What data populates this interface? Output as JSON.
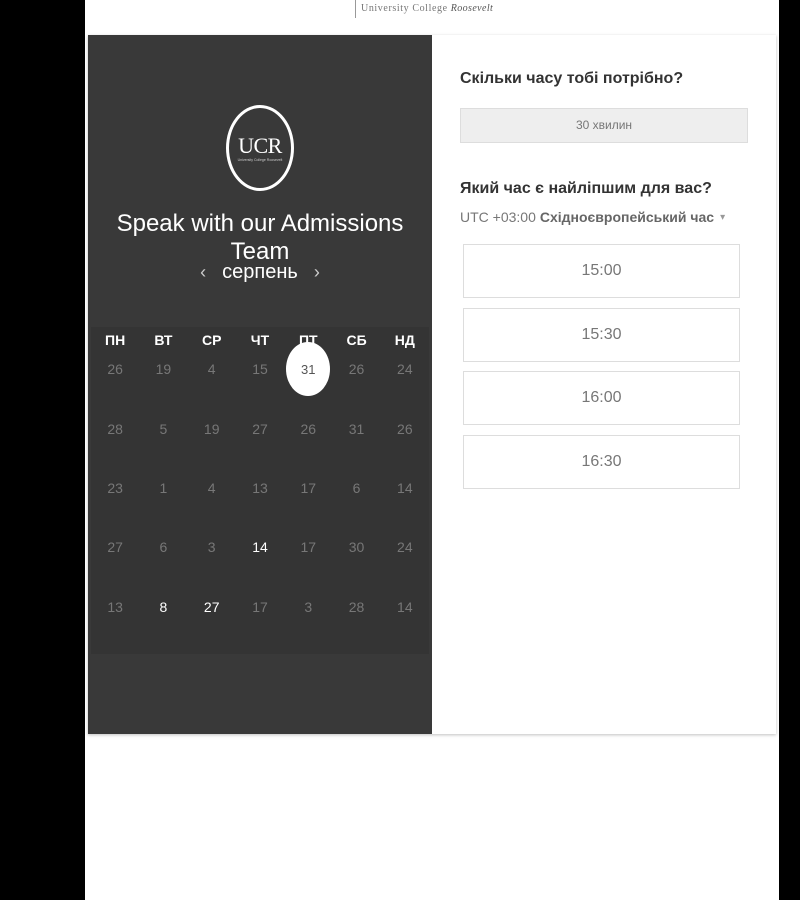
{
  "header": {
    "logo_text": "University College",
    "logo_emphasis": "Roosevelt"
  },
  "left_panel": {
    "logo": {
      "text": "UCR",
      "subtext": "University College Roosevelt"
    },
    "title": "Speak with our Admissions Team",
    "month": "серпень",
    "prev_icon": "‹",
    "next_icon": "›",
    "weekdays": [
      "ПН",
      "ВТ",
      "СР",
      "ЧТ",
      "ПТ",
      "СБ",
      "НД"
    ],
    "weeks": [
      [
        "26",
        "19",
        "4",
        "15",
        "31",
        "26",
        "24"
      ],
      [
        "28",
        "5",
        "19",
        "27",
        "26",
        "31",
        "26"
      ],
      [
        "23",
        "1",
        "4",
        "13",
        "17",
        "6",
        "14"
      ],
      [
        "27",
        "6",
        "3",
        "14",
        "17",
        "30",
        "24"
      ],
      [
        "13",
        "8",
        "27",
        "17",
        "3",
        "28",
        "14"
      ]
    ],
    "active_days": [
      "3.3",
      "4.1",
      "4.2"
    ],
    "selected_day": "0.4"
  },
  "right_panel": {
    "duration_question": "Скільки часу тобі потрібно?",
    "duration_value": "30 хвилин",
    "time_question": "Який час є найліпшим для вас?",
    "timezone_offset": "UTC +03:00",
    "timezone_name": "Східноєвропейський час",
    "timezone_caret": "▾",
    "slots": [
      "15:00",
      "15:30",
      "16:00",
      "16:30"
    ]
  }
}
